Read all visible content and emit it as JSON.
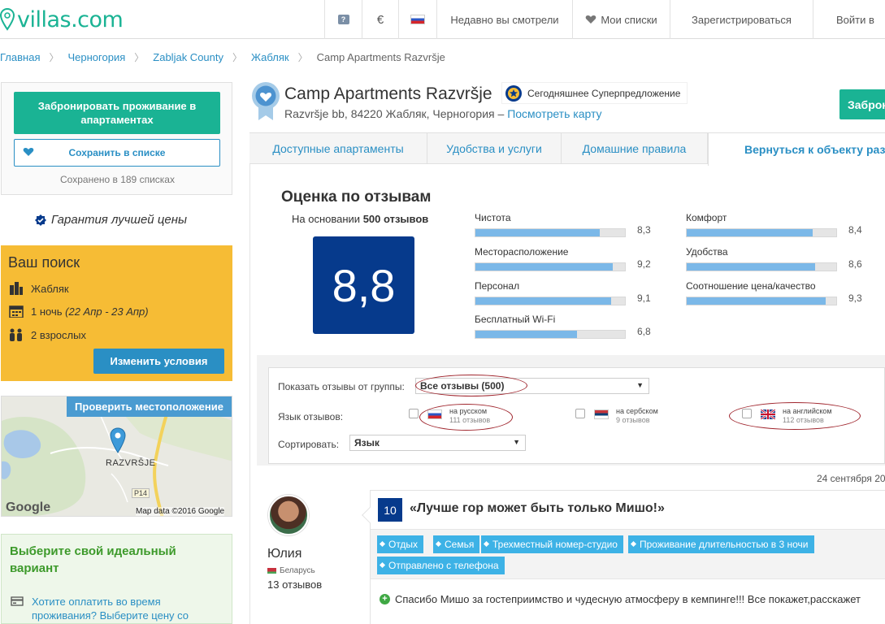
{
  "header": {
    "logo_text": "villas.com",
    "currency_symbol": "€",
    "recent_label": "Недавно вы смотрели",
    "lists_label": "Мои списки",
    "register_label": "Зарегистрироваться",
    "login_label": "Войти в"
  },
  "breadcrumb": [
    "Главная",
    "Черногория",
    "Zabljak County",
    "Жабляк",
    "Camp Apartments Razvršje"
  ],
  "sidebar": {
    "book_label": "Забронировать проживание в апартаментах",
    "save_label": "Сохранить в списке",
    "saved_count": "Сохранено в 189 списках",
    "guarantee": "Гарантия лучшей цены"
  },
  "search": {
    "title": "Ваш поиск",
    "city": "Жабляк",
    "nights": "1 ночь",
    "dates": "(22 Апр - 23 Апр)",
    "guests": "2 взрослых",
    "change_label": "Изменить условия"
  },
  "map": {
    "check_location": "Проверить местоположение",
    "place_label": "RAZVRŠJE",
    "road_label": "P14",
    "google": "Google",
    "copyright": "Map data ©2016 Google"
  },
  "ideal": {
    "title": "Выберите свой идеальный вариант",
    "text": "Хотите оплатить во время проживания? Выберите цену со"
  },
  "property": {
    "name": "Camp Apartments Razvršje",
    "deal": "Сегодняшнее Суперпредложение",
    "address": "Razvršje bb, 84220 Жабляк, Черногория –",
    "map_link": "Посмотреть карту",
    "book_top": "Забронировать"
  },
  "tabs": [
    {
      "label": "Доступные апартаменты"
    },
    {
      "label": "Удобства и услуги"
    },
    {
      "label": "Домашние правила"
    },
    {
      "label": "Вернуться к объекту размещения"
    }
  ],
  "scores": {
    "title": "Оценка по отзывам",
    "based_prefix": "На основании",
    "based_count": "500 отзывов",
    "overall": "8,8",
    "categories": [
      {
        "label": "Чистота",
        "value": "8,3",
        "fraction": 0.83
      },
      {
        "label": "Месторасположение",
        "value": "9,2",
        "fraction": 0.92
      },
      {
        "label": "Персонал",
        "value": "9,1",
        "fraction": 0.91
      },
      {
        "label": "Бесплатный Wi-Fi",
        "value": "6,8",
        "fraction": 0.68
      },
      {
        "label": "Комфорт",
        "value": "8,4",
        "fraction": 0.84
      },
      {
        "label": "Удобства",
        "value": "8,6",
        "fraction": 0.86
      },
      {
        "label": "Соотношение цена/качество",
        "value": "9,3",
        "fraction": 0.93
      }
    ]
  },
  "filter": {
    "group_label": "Показать отзывы от группы:",
    "group_value": "Все отзывы (500)",
    "lang_label": "Язык отзывов:",
    "languages": [
      {
        "name": "на русском",
        "count": "111 отзывов"
      },
      {
        "name": "на сербском",
        "count": "9 отзывов"
      },
      {
        "name": "на английском",
        "count": "112 отзывов"
      }
    ],
    "sort_label": "Сортировать:",
    "sort_value": "Язык"
  },
  "review": {
    "date": "24 сентября 20",
    "reviewer_name": "Юлия",
    "reviewer_country": "Беларусь",
    "reviewer_reviews": "13 отзывов",
    "score": "10",
    "title": "«Лучше гор может быть только Мишо!»",
    "tags": [
      "Отдых",
      "Семья",
      "Трехместный номер-студио",
      "Проживание длительностью в 3 ночи",
      "Отправлено с телефона"
    ],
    "positive": "Спасибо Мишо за гостеприимство и чудесную атмосферу в кемпинге!!! Все покажет,расскажет"
  },
  "colors": {
    "brand_green": "#1ab394",
    "brand_blue": "#2a8fc4",
    "score_navy": "#063a8c",
    "search_yellow": "#f6bc35",
    "bar_fill": "#7bb8e8"
  }
}
